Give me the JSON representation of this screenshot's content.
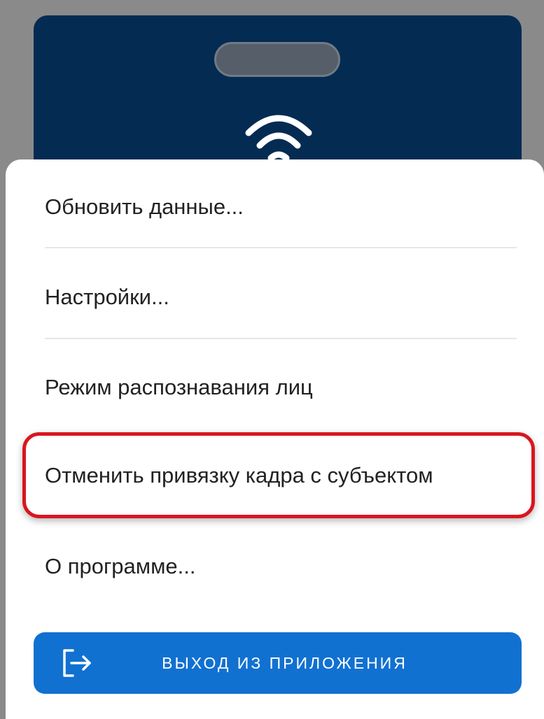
{
  "card": {
    "icon": "nfc-wave-icon",
    "background_color": "#042b52"
  },
  "menu": {
    "items": [
      {
        "label": "Обновить данные..."
      },
      {
        "label": "Настройки..."
      },
      {
        "label": "Режим распознавания лиц"
      },
      {
        "label": "Отменить привязку кадра с субъектом",
        "highlighted": true
      },
      {
        "label": "О программе..."
      }
    ]
  },
  "exit_button": {
    "label": "ВЫХОД ИЗ ПРИЛОЖЕНИЯ",
    "icon": "logout-icon",
    "color": "#1171d1"
  },
  "highlight_color": "#d9161f"
}
